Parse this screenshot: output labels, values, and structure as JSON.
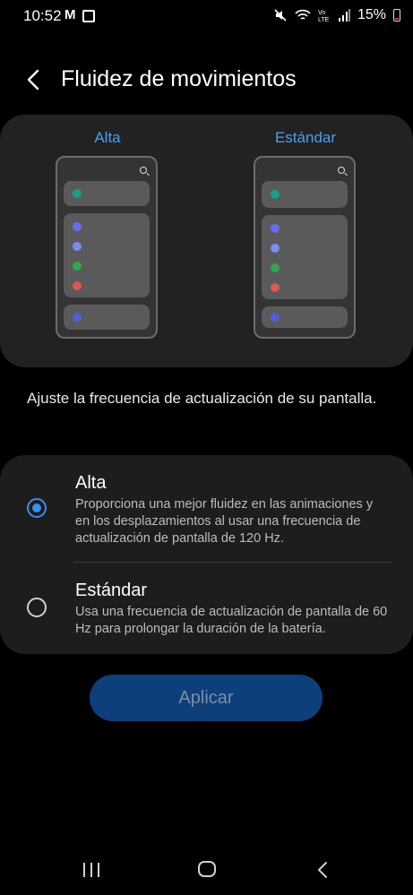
{
  "status_bar": {
    "time": "10:52",
    "battery": "15%",
    "icons": [
      "gmail-icon",
      "gallery-icon",
      "mute-icon",
      "wifi-icon",
      "volte-icon",
      "signal-icon",
      "battery-icon"
    ]
  },
  "header": {
    "title": "Fluidez de movimientos"
  },
  "preview": {
    "left_label": "Alta",
    "right_label": "Estándar",
    "dot_colors": [
      "#16a085",
      "#6a6cf0",
      "#7b8cf3",
      "#2fa84f",
      "#e0574d",
      "#4f5fe0"
    ]
  },
  "description": "Ajuste la frecuencia de actualización de su pantalla.",
  "options": [
    {
      "title": "Alta",
      "desc": "Proporciona una mejor fluidez en las animaciones y en los desplazamientos al usar una frecuencia de actualización de pantalla de 120 Hz.",
      "selected": true
    },
    {
      "title": "Estándar",
      "desc": "Usa una frecuencia de actualización de pantalla de 60 Hz para prolongar la duración de la batería.",
      "selected": false
    }
  ],
  "apply_label": "Aplicar",
  "colors": {
    "accent": "#3b8df0",
    "card_bg": "#222222",
    "apply_bg": "#0d3f7a"
  }
}
